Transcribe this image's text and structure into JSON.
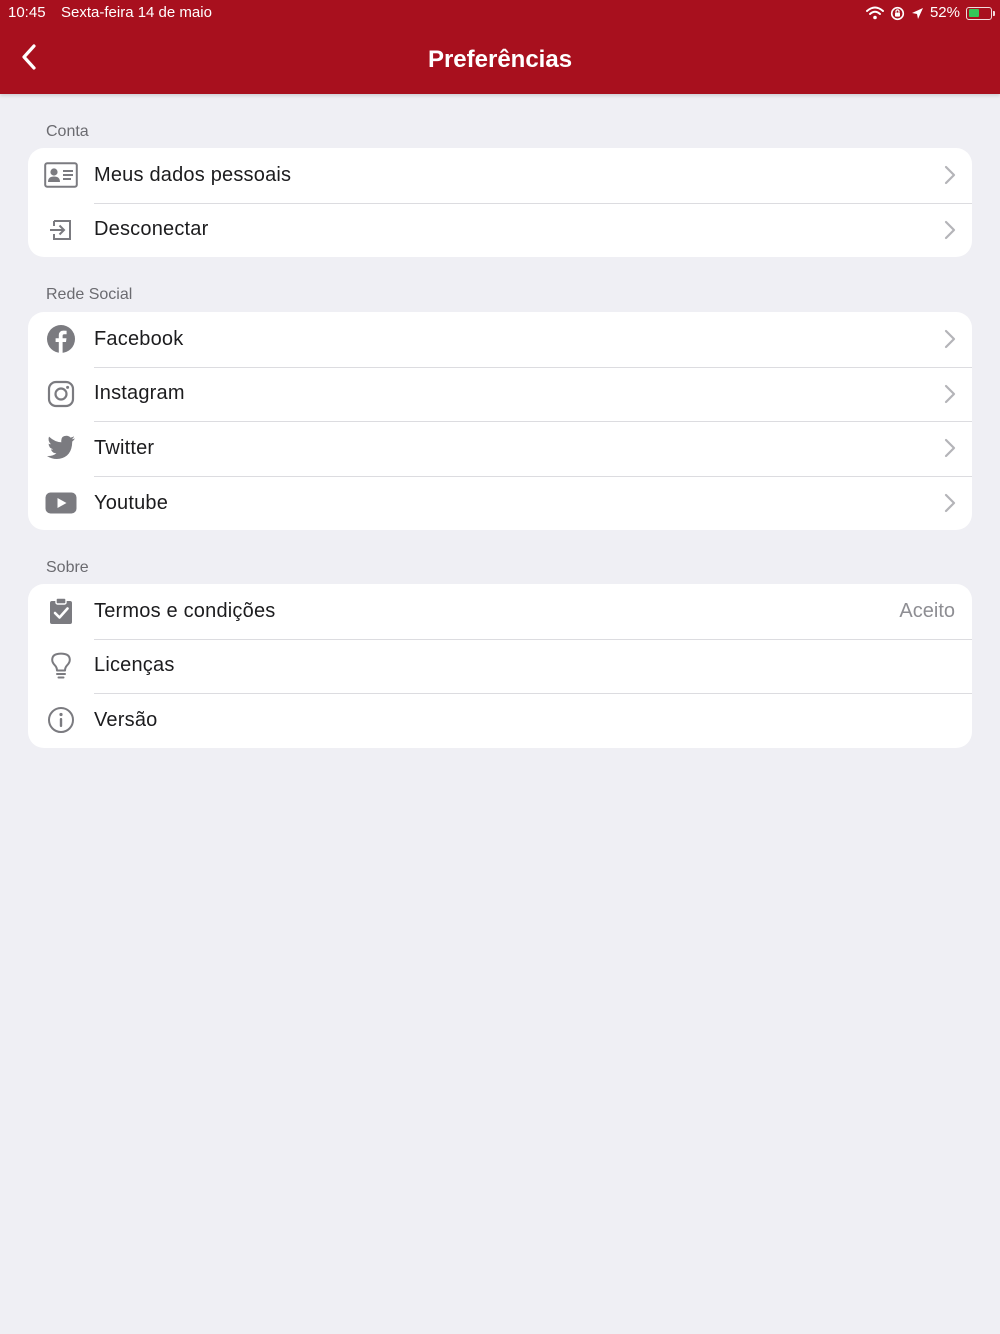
{
  "status_bar": {
    "time": "10:45",
    "date": "Sexta-feira 14 de maio",
    "battery": "52%",
    "battery_level": 0.52,
    "icons": [
      "wifi-icon",
      "orientation-lock-icon",
      "location-icon",
      "battery-charging-icon"
    ]
  },
  "nav": {
    "title": "Preferências",
    "back_icon": "chevron-left-icon"
  },
  "sections": {
    "conta": {
      "header": "Conta",
      "items": [
        {
          "label": "Meus dados pessoais",
          "icon": "id-card-icon"
        },
        {
          "label": "Desconectar",
          "icon": "sign-out-icon"
        }
      ]
    },
    "rede_social": {
      "header": "Rede Social",
      "items": [
        {
          "label": "Facebook",
          "icon": "facebook-icon"
        },
        {
          "label": "Instagram",
          "icon": "instagram-icon"
        },
        {
          "label": "Twitter",
          "icon": "twitter-icon"
        },
        {
          "label": "Youtube",
          "icon": "youtube-icon"
        }
      ]
    },
    "sobre": {
      "header": "Sobre",
      "items": [
        {
          "label": "Termos e condições",
          "detail": "Aceito",
          "icon": "clipboard-check-icon"
        },
        {
          "label": "Licenças",
          "icon": "lightbulb-icon"
        },
        {
          "label": "Versão",
          "icon": "info-icon"
        }
      ]
    }
  },
  "colors": {
    "brand": "#a8101e",
    "background": "#efeff4",
    "icon_gray": "#7b7b80",
    "chevron": "#b4b4b8",
    "battery_green": "#34c759"
  }
}
